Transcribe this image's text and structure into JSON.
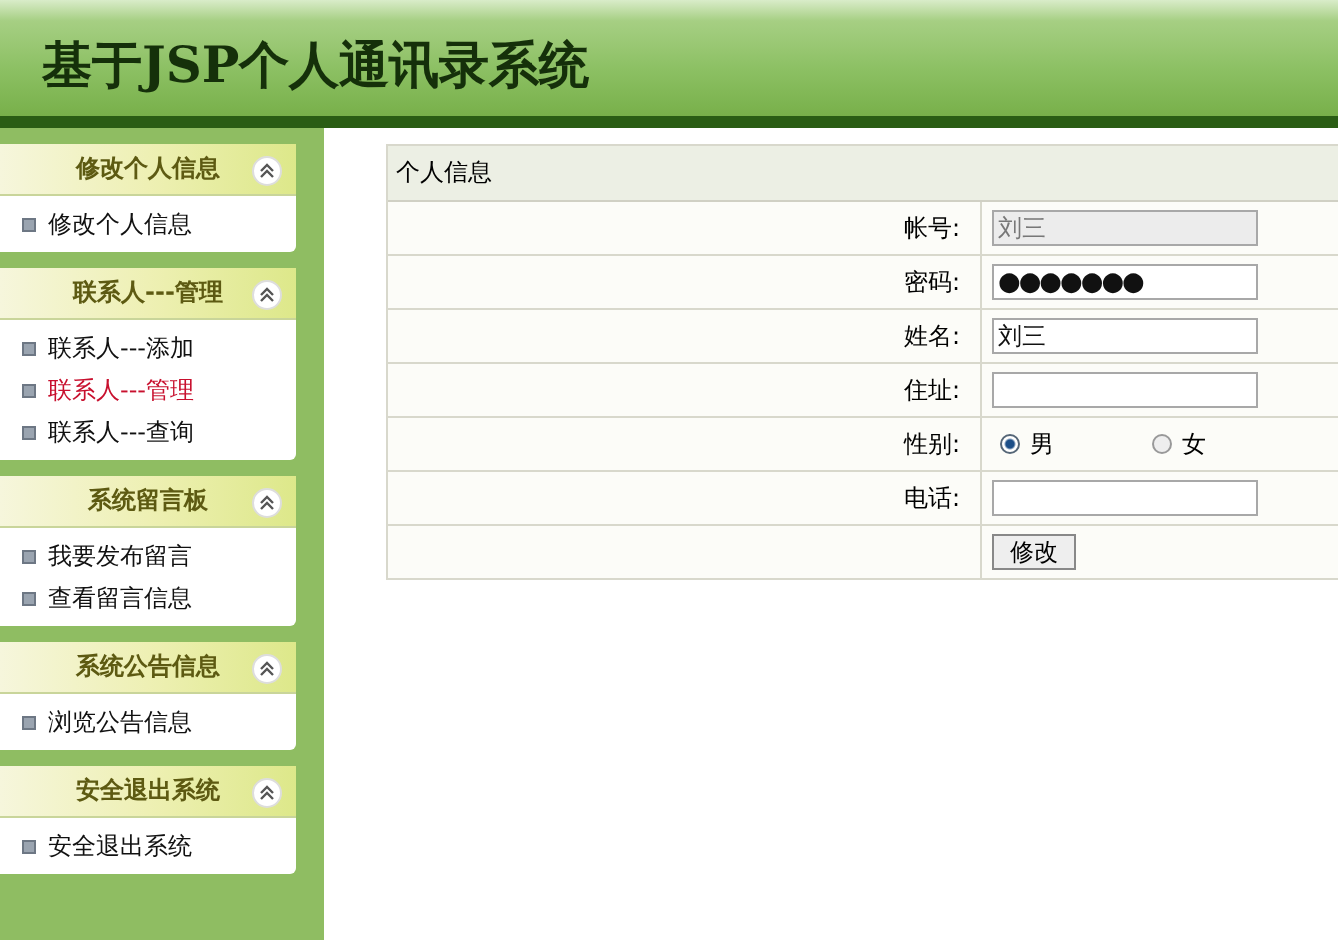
{
  "header": {
    "title": "基于JSP个人通讯录系统"
  },
  "sidebar": {
    "sections": [
      {
        "title": "修改个人信息",
        "expanded": true,
        "items": [
          {
            "label": "修改个人信息",
            "selected": false
          }
        ]
      },
      {
        "title": "联系人---管理",
        "expanded": true,
        "items": [
          {
            "label": "联系人---添加",
            "selected": false
          },
          {
            "label": "联系人---管理",
            "selected": true
          },
          {
            "label": "联系人---查询",
            "selected": false
          }
        ]
      },
      {
        "title": "系统留言板",
        "expanded": true,
        "items": [
          {
            "label": "我要发布留言",
            "selected": false
          },
          {
            "label": "查看留言信息",
            "selected": false
          }
        ]
      },
      {
        "title": "系统公告信息",
        "expanded": true,
        "items": [
          {
            "label": "浏览公告信息",
            "selected": false
          }
        ]
      },
      {
        "title": "安全退出系统",
        "expanded": true,
        "items": [
          {
            "label": "安全退出系统",
            "selected": false
          }
        ]
      }
    ]
  },
  "form": {
    "title": "个人信息",
    "rows": [
      {
        "kind": "text",
        "label": "帐号:",
        "value": "刘三",
        "disabled": true
      },
      {
        "kind": "password",
        "label": "密码:",
        "value": "●●●●●●●",
        "disabled": false
      },
      {
        "kind": "text",
        "label": "姓名:",
        "value": "刘三",
        "disabled": false
      },
      {
        "kind": "text",
        "label": "住址:",
        "disabled": false
      },
      {
        "kind": "radio",
        "label": "性别:",
        "options": [
          {
            "label": "男",
            "selected": true
          },
          {
            "label": "女",
            "selected": false
          }
        ]
      },
      {
        "kind": "text",
        "label": "电话:",
        "disabled": false
      },
      {
        "kind": "button",
        "label": "修改"
      }
    ]
  }
}
